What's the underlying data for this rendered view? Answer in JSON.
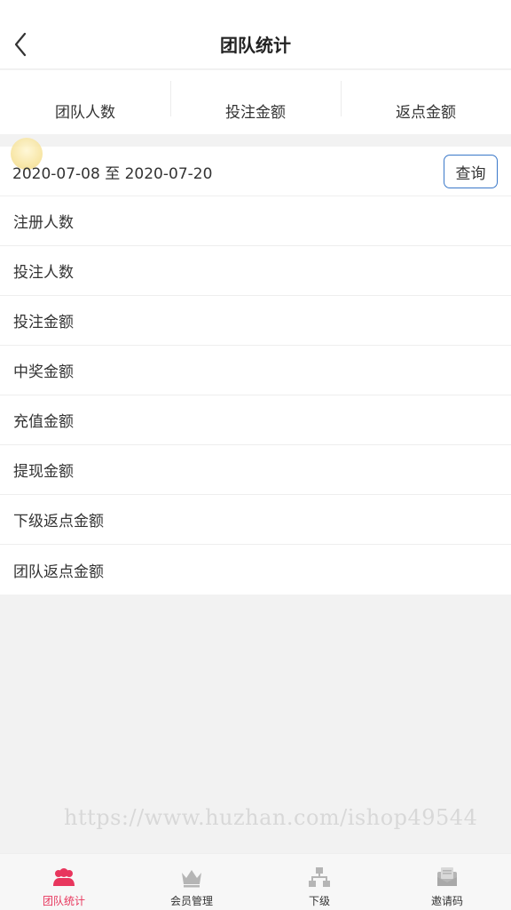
{
  "header": {
    "title": "团队统计"
  },
  "summary": [
    {
      "label": "团队人数"
    },
    {
      "label": "投注金额"
    },
    {
      "label": "返点金额"
    }
  ],
  "filter": {
    "date_range": "2020-07-08 至 2020-07-20",
    "query_label": "查询"
  },
  "stats": [
    {
      "label": "注册人数",
      "value": ""
    },
    {
      "label": "投注人数",
      "value": ""
    },
    {
      "label": "投注金额",
      "value": ""
    },
    {
      "label": "中奖金额",
      "value": ""
    },
    {
      "label": "充值金额",
      "value": ""
    },
    {
      "label": "提现金额",
      "value": ""
    },
    {
      "label": "下级返点金额",
      "value": ""
    },
    {
      "label": "团队返点金额",
      "value": ""
    }
  ],
  "watermark": "https://www.huzhan.com/ishop49544",
  "tabbar": {
    "items": [
      {
        "label": "团队统计",
        "icon": "team-icon",
        "active": true
      },
      {
        "label": "会员管理",
        "icon": "crown-icon",
        "active": false
      },
      {
        "label": "下级",
        "icon": "hierarchy-icon",
        "active": false
      },
      {
        "label": "邀请码",
        "icon": "envelope-icon",
        "active": false
      }
    ]
  },
  "colors": {
    "accent": "#e8365d",
    "button_border": "#3a78c9",
    "inactive_icon": "#b5b5b5"
  }
}
